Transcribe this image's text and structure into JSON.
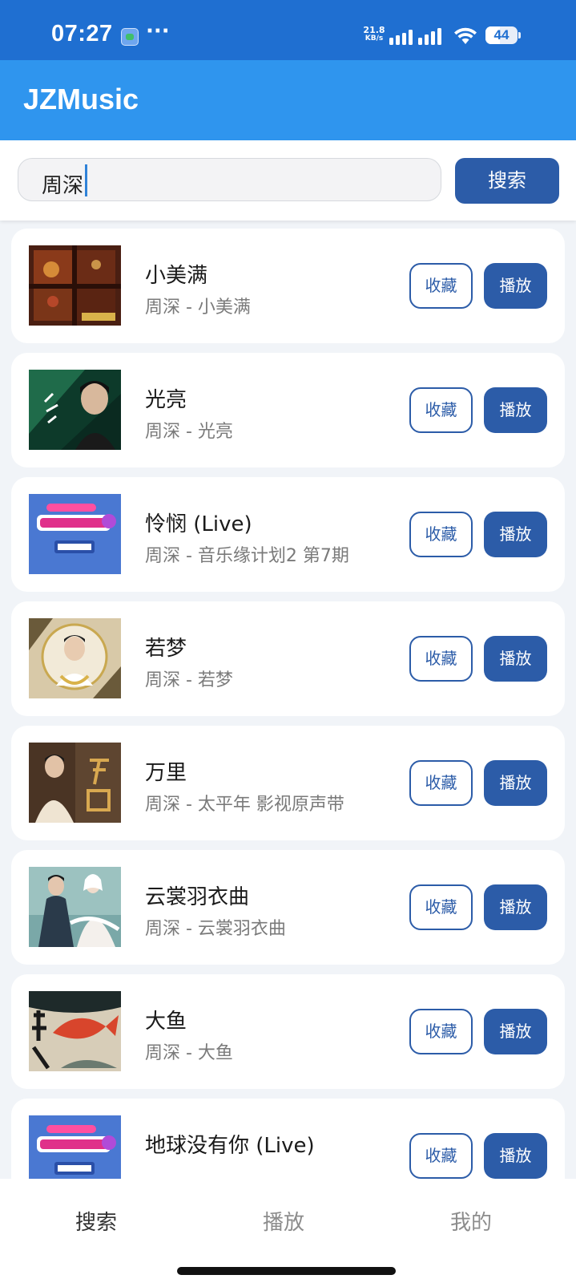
{
  "status_bar": {
    "time": "07:27",
    "more": "···",
    "net_speed_value": "21.8",
    "net_speed_unit": "KB/s",
    "battery_level": "44",
    "battery_fraction": 0.44
  },
  "app_bar": {
    "title": "JZMusic"
  },
  "search": {
    "query": "周深",
    "button_label": "搜索"
  },
  "song_actions": {
    "favorite_label": "收藏",
    "play_label": "播放"
  },
  "results": [
    {
      "title": "小美满",
      "subtitle": "周深 - 小美满",
      "cover_icon": "album-cover-warm-window"
    },
    {
      "title": "光亮",
      "subtitle": "周深 - 光亮",
      "cover_icon": "album-cover-green-portrait"
    },
    {
      "title": "怜悯 (Live)",
      "subtitle": "周深 - 音乐缘计划2 第7期",
      "cover_icon": "album-cover-show-logo"
    },
    {
      "title": "若梦",
      "subtitle": "周深 - 若梦",
      "cover_icon": "album-cover-circle-portrait"
    },
    {
      "title": "万里",
      "subtitle": "周深 - 太平年 影视原声带",
      "cover_icon": "album-cover-brown-portrait"
    },
    {
      "title": "云裳羽衣曲",
      "subtitle": "周深 - 云裳羽衣曲",
      "cover_icon": "album-cover-costume-duo"
    },
    {
      "title": "大鱼",
      "subtitle": "周深 - 大鱼",
      "cover_icon": "album-cover-red-fish"
    },
    {
      "title": "地球没有你 (Live)",
      "subtitle": "",
      "cover_icon": "album-cover-show-logo"
    }
  ],
  "bottom_nav": {
    "tabs": [
      "搜索",
      "播放",
      "我的"
    ],
    "active_tab": "搜索"
  },
  "colors": {
    "status_bar_bg": "#1f6fd1",
    "app_bar_bg": "#2f95ee",
    "primary_button": "#2c5ca8",
    "page_bg": "#f1f4f8"
  }
}
